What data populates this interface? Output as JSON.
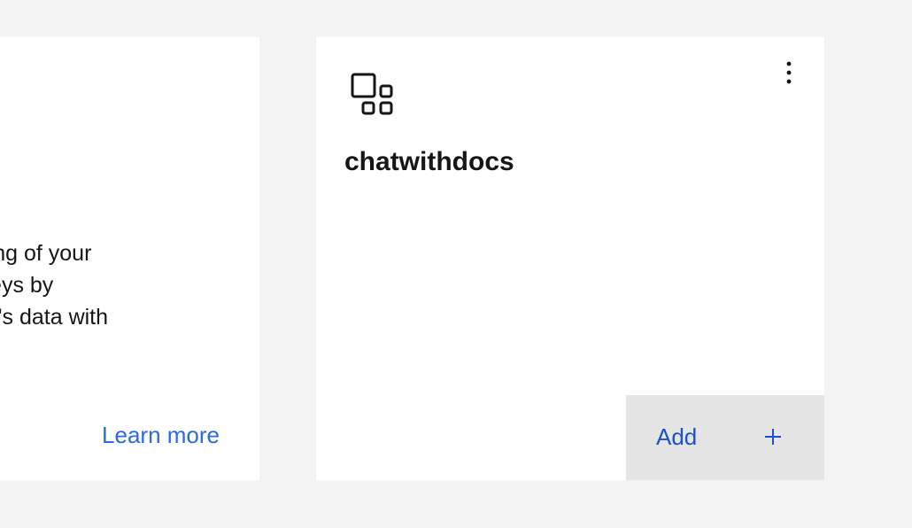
{
  "left_card": {
    "description_lines": [
      "tanding of your",
      "ourneys by",
      "istant's data with"
    ],
    "learn_more_label": "Learn more"
  },
  "right_card": {
    "icon": "apps-grid-icon",
    "title": "chatwithdocs",
    "menu_icon": "overflow-menu-vertical-icon",
    "add_label": "Add",
    "add_icon": "plus-icon"
  },
  "colors": {
    "background": "#f3f3f3",
    "card": "#ffffff",
    "link": "#2c6ae0",
    "add_text": "#1d4fd1",
    "add_bg": "#e5e5e5"
  }
}
